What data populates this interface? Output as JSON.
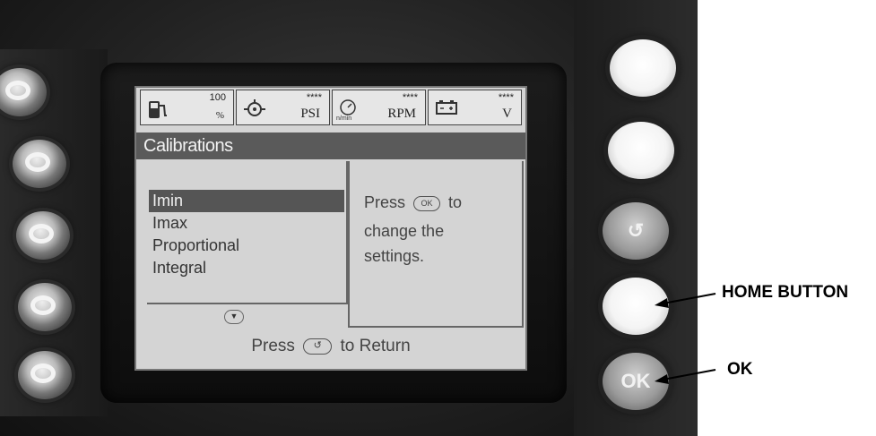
{
  "status_bar": {
    "fuel": {
      "value": "100",
      "unit": "%",
      "icon": "fuel-pump-icon"
    },
    "pressure": {
      "value": "****",
      "unit": "PSI",
      "icon": "oil-pressure-icon"
    },
    "speed": {
      "value": "****",
      "unit": "RPM",
      "sub": "n/min",
      "icon": "engine-speed-icon"
    },
    "voltage": {
      "value": "****",
      "unit": "V",
      "icon": "battery-icon"
    }
  },
  "screen": {
    "title": "Calibrations",
    "menu_items": [
      {
        "label": "Imin",
        "selected": true
      },
      {
        "label": "Imax",
        "selected": false
      },
      {
        "label": "Proportional",
        "selected": false
      },
      {
        "label": "Integral",
        "selected": false
      }
    ],
    "info": {
      "line1_pre": "Press",
      "ok_glyph": "OK",
      "line1_post": "to",
      "line2": "change the",
      "line3": "settings."
    },
    "footer": {
      "pre": "Press",
      "post": "to Return"
    }
  },
  "buttons": {
    "ok_glyph": "OK",
    "back_glyph": "↺"
  },
  "annotations": {
    "home_button": "HOME BUTTON",
    "ok": "OK"
  },
  "colors": {
    "screen_bg": "#d4d4d4",
    "title_bar": "#5a5a5a",
    "selection": "#555555"
  }
}
